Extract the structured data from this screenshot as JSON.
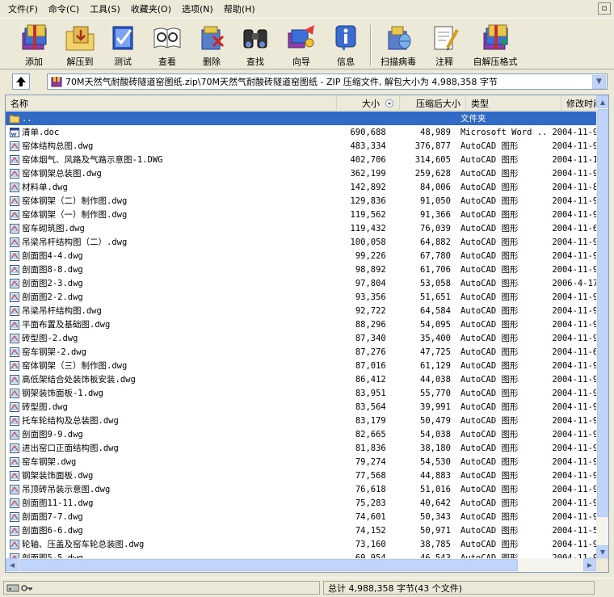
{
  "menu": [
    "文件(F)",
    "命令(C)",
    "工具(S)",
    "收藏夹(O)",
    "选项(N)",
    "帮助(H)"
  ],
  "toolbar": {
    "add": "添加",
    "extract_to": "解压到",
    "test": "测试",
    "view": "查看",
    "delete": "删除",
    "find": "查找",
    "wizard": "向导",
    "info": "信息",
    "virus_scan": "扫描病毒",
    "comment": "注释",
    "sfx": "自解压格式"
  },
  "path": "70M天然气耐酸砖隧道窑图纸.zip\\70M天然气耐酸砖隧道窑图纸 - ZIP 压缩文件, 解包大小为 4,988,358 字节",
  "columns": {
    "name": "名称",
    "size": "大小",
    "packed": "压缩后大小",
    "type": "类型",
    "modified": "修改时间"
  },
  "files": [
    {
      "name": "..",
      "size": "",
      "packed": "",
      "type": "文件夹",
      "date": "",
      "icon": "folder",
      "selected": true
    },
    {
      "name": "清单.doc",
      "size": "690,688",
      "packed": "48,989",
      "type": "Microsoft Word ...",
      "date": "2004-11-9",
      "icon": "word"
    },
    {
      "name": "窑体结构总图.dwg",
      "size": "483,334",
      "packed": "376,877",
      "type": "AutoCAD 图形",
      "date": "2004-11-9",
      "icon": "dwg"
    },
    {
      "name": "窑体烟气、风路及气路示意图-1.DWG",
      "size": "402,706",
      "packed": "314,605",
      "type": "AutoCAD 图形",
      "date": "2004-11-1",
      "icon": "dwg"
    },
    {
      "name": "窑体钢架总装图.dwg",
      "size": "362,199",
      "packed": "259,628",
      "type": "AutoCAD 图形",
      "date": "2004-11-9",
      "icon": "dwg"
    },
    {
      "name": "材料单.dwg",
      "size": "142,892",
      "packed": "84,006",
      "type": "AutoCAD 图形",
      "date": "2004-11-8",
      "icon": "dwg"
    },
    {
      "name": "窑体钢架（二）制作图.dwg",
      "size": "129,836",
      "packed": "91,050",
      "type": "AutoCAD 图形",
      "date": "2004-11-9",
      "icon": "dwg"
    },
    {
      "name": "窑体钢架（一）制作图.dwg",
      "size": "119,562",
      "packed": "91,366",
      "type": "AutoCAD 图形",
      "date": "2004-11-9",
      "icon": "dwg"
    },
    {
      "name": "窑车砌筑图.dwg",
      "size": "119,432",
      "packed": "76,039",
      "type": "AutoCAD 图形",
      "date": "2004-11-6",
      "icon": "dwg"
    },
    {
      "name": "吊梁吊杆结构图（二）.dwg",
      "size": "100,058",
      "packed": "64,882",
      "type": "AutoCAD 图形",
      "date": "2004-11-9",
      "icon": "dwg"
    },
    {
      "name": "剖面图4-4.dwg",
      "size": "99,226",
      "packed": "67,780",
      "type": "AutoCAD 图形",
      "date": "2004-11-9",
      "icon": "dwg"
    },
    {
      "name": "剖面图8-8.dwg",
      "size": "98,892",
      "packed": "61,706",
      "type": "AutoCAD 图形",
      "date": "2004-11-9",
      "icon": "dwg"
    },
    {
      "name": "剖面图2-3.dwg",
      "size": "97,804",
      "packed": "53,058",
      "type": "AutoCAD 图形",
      "date": "2006-4-17",
      "icon": "dwg"
    },
    {
      "name": "剖面图2-2.dwg",
      "size": "93,356",
      "packed": "51,651",
      "type": "AutoCAD 图形",
      "date": "2004-11-9",
      "icon": "dwg"
    },
    {
      "name": "吊梁吊杆结构图.dwg",
      "size": "92,722",
      "packed": "64,584",
      "type": "AutoCAD 图形",
      "date": "2004-11-9",
      "icon": "dwg"
    },
    {
      "name": "平面布置及基础图.dwg",
      "size": "88,296",
      "packed": "54,095",
      "type": "AutoCAD 图形",
      "date": "2004-11-9",
      "icon": "dwg"
    },
    {
      "name": "砖型图-2.dwg",
      "size": "87,340",
      "packed": "35,400",
      "type": "AutoCAD 图形",
      "date": "2004-11-9",
      "icon": "dwg"
    },
    {
      "name": "窑车钢架-2.dwg",
      "size": "87,276",
      "packed": "47,725",
      "type": "AutoCAD 图形",
      "date": "2004-11-6",
      "icon": "dwg"
    },
    {
      "name": "窑体钢架（三）制作图.dwg",
      "size": "87,016",
      "packed": "61,129",
      "type": "AutoCAD 图形",
      "date": "2004-11-9",
      "icon": "dwg"
    },
    {
      "name": "高低架结合处装饰板安装.dwg",
      "size": "86,412",
      "packed": "44,038",
      "type": "AutoCAD 图形",
      "date": "2004-11-9",
      "icon": "dwg"
    },
    {
      "name": "钢架装饰面板-1.dwg",
      "size": "83,951",
      "packed": "55,770",
      "type": "AutoCAD 图形",
      "date": "2004-11-9",
      "icon": "dwg"
    },
    {
      "name": "砖型图.dwg",
      "size": "83,564",
      "packed": "39,991",
      "type": "AutoCAD 图形",
      "date": "2004-11-9",
      "icon": "dwg"
    },
    {
      "name": "托车轮结构及总装图.dwg",
      "size": "83,179",
      "packed": "50,479",
      "type": "AutoCAD 图形",
      "date": "2004-11-9",
      "icon": "dwg"
    },
    {
      "name": "剖面图9-9.dwg",
      "size": "82,665",
      "packed": "54,038",
      "type": "AutoCAD 图形",
      "date": "2004-11-9",
      "icon": "dwg"
    },
    {
      "name": "进出窑口正面结构图.dwg",
      "size": "81,836",
      "packed": "38,180",
      "type": "AutoCAD 图形",
      "date": "2004-11-9",
      "icon": "dwg"
    },
    {
      "name": "窑车钢架.dwg",
      "size": "79,274",
      "packed": "54,530",
      "type": "AutoCAD 图形",
      "date": "2004-11-9",
      "icon": "dwg"
    },
    {
      "name": "钢架装饰面板.dwg",
      "size": "77,568",
      "packed": "44,883",
      "type": "AutoCAD 图形",
      "date": "2004-11-9",
      "icon": "dwg"
    },
    {
      "name": "吊顶砖吊装示意图.dwg",
      "size": "76,618",
      "packed": "51,016",
      "type": "AutoCAD 图形",
      "date": "2004-11-9",
      "icon": "dwg"
    },
    {
      "name": "剖面图11-11.dwg",
      "size": "75,283",
      "packed": "40,642",
      "type": "AutoCAD 图形",
      "date": "2004-11-9",
      "icon": "dwg"
    },
    {
      "name": "剖面图7-7.dwg",
      "size": "74,601",
      "packed": "50,343",
      "type": "AutoCAD 图形",
      "date": "2004-11-9",
      "icon": "dwg"
    },
    {
      "name": "剖面图6-6.dwg",
      "size": "74,152",
      "packed": "50,971",
      "type": "AutoCAD 图形",
      "date": "2004-11-5",
      "icon": "dwg"
    },
    {
      "name": "轮轴、压盖及窑车轮总装图.dwg",
      "size": "73,160",
      "packed": "38,785",
      "type": "AutoCAD 图形",
      "date": "2004-11-9",
      "icon": "dwg"
    },
    {
      "name": "剖面图5-5.dwg",
      "size": "69,954",
      "packed": "46,543",
      "type": "AutoCAD 图形",
      "date": "2004-11-9",
      "icon": "dwg"
    }
  ],
  "status": {
    "total": "总计 4,988,358 字节(43 个文件)"
  },
  "colors": {
    "selection": "#316AC5",
    "window_bg": "#ECE9D8"
  }
}
